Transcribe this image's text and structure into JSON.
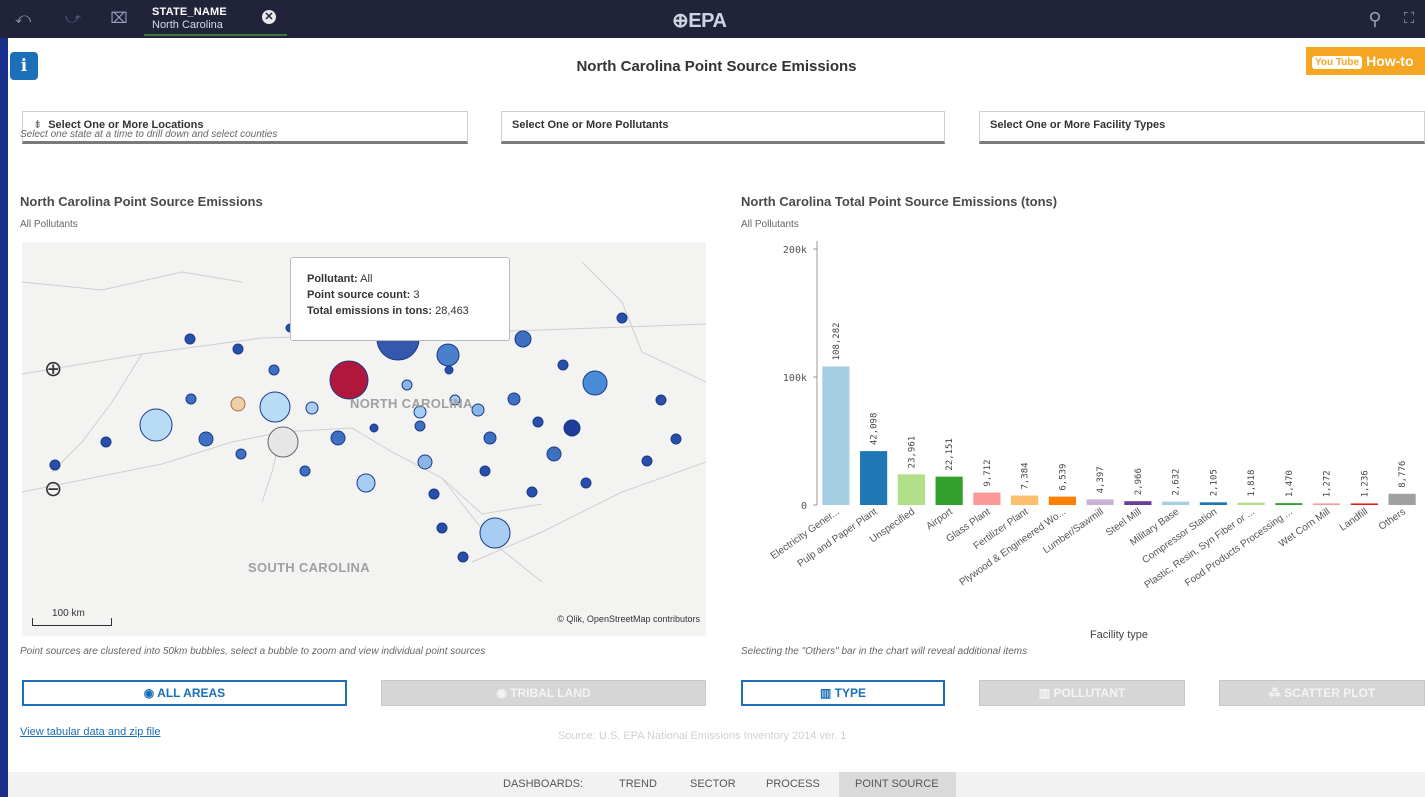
{
  "toolbar": {
    "selection": {
      "field": "STATE_NAME",
      "value": "North Carolina"
    },
    "logo": "⊕EPA"
  },
  "page": {
    "title": "North Carolina Point Source Emissions",
    "howto_label": "How-to",
    "youtube_badge": "You Tube"
  },
  "filters": {
    "locations": "Select One or More Locations",
    "pollutants": "Select One or More Pollutants",
    "facility_types": "Select One or More Facility Types",
    "hint": "Select one state at a time to drill down and select counties"
  },
  "map_panel": {
    "title": "North Carolina Point Source Emissions",
    "subtitle": "All Pollutants",
    "tooltip": {
      "pollutant_label": "Pollutant:",
      "pollutant_value": "All",
      "count_label": "Point source count:",
      "count_value": "3",
      "total_label": "Total emissions in tons:",
      "total_value": "28,463"
    },
    "state_labels": [
      "NORTH CAROLINA",
      "SOUTH CAROLINA"
    ],
    "scale": "100 km",
    "attribution": "© Qlik, OpenStreetMap contributors",
    "note": "Point sources are clustered into 50km bubbles, select a bubble to zoom and view individual point sources"
  },
  "bar_panel": {
    "title": "North Carolina Total Point Source Emissions (tons)",
    "subtitle": "All Pollutants",
    "note": "Selecting the \"Others\" bar in the chart will reveal additional items"
  },
  "chart_data": {
    "type": "bar",
    "title": "North Carolina Total Point Source Emissions (tons)",
    "xlabel": "Facility type",
    "ylabel": "",
    "ylim": [
      0,
      200000
    ],
    "yticks": [
      "200k",
      "100k",
      "0"
    ],
    "categories": [
      "Electricity Gener...",
      "Pulp and Paper Plant",
      "Unspecified",
      "Airport",
      "Glass Plant",
      "Fertilizer Plant",
      "Plywood & Engineered Wo...",
      "Lumber/Sawmill",
      "Steel Mill",
      "Military Base",
      "Compressor Station",
      "Plastic, Resin, Syn Fiber or ...",
      "Food Products Processing ...",
      "Wet Corn Mill",
      "Landfill",
      "Others"
    ],
    "values": [
      108282,
      42098,
      23961,
      22151,
      9712,
      7384,
      6539,
      4397,
      2966,
      2632,
      2105,
      1818,
      1470,
      1272,
      1236,
      8776
    ],
    "labels": [
      "108,282",
      "42,098",
      "23,961",
      "22,151",
      "9,712",
      "7,384",
      "6,539",
      "4,397",
      "2,966",
      "2,632",
      "2,105",
      "1,818",
      "1,470",
      "1,272",
      "1,236",
      "8,776"
    ],
    "colors": [
      "#a6cee3",
      "#1f78b4",
      "#b2df8a",
      "#33a02c",
      "#fb9a99",
      "#fdbf6f",
      "#ff7f00",
      "#cab2d6",
      "#6a3d9a",
      "#a6cee3",
      "#1f78b4",
      "#b2df8a",
      "#33a02c",
      "#fb9a99",
      "#e31a1c",
      "#a0a0a0"
    ]
  },
  "buttons": {
    "all_areas": "ALL AREAS",
    "tribal_land": "TRIBAL LAND",
    "type": "TYPE",
    "pollutant": "POLLUTANT",
    "scatter": "SCATTER PLOT"
  },
  "footer": {
    "link": "View tabular data and zip file",
    "source": "Source: U.S. EPA National Emissions Inventory 2014 ver. 1"
  },
  "bottom_nav": {
    "label": "DASHBOARDS:",
    "items": [
      "TREND",
      "SECTOR",
      "PROCESS",
      "POINT SOURCE"
    ]
  }
}
